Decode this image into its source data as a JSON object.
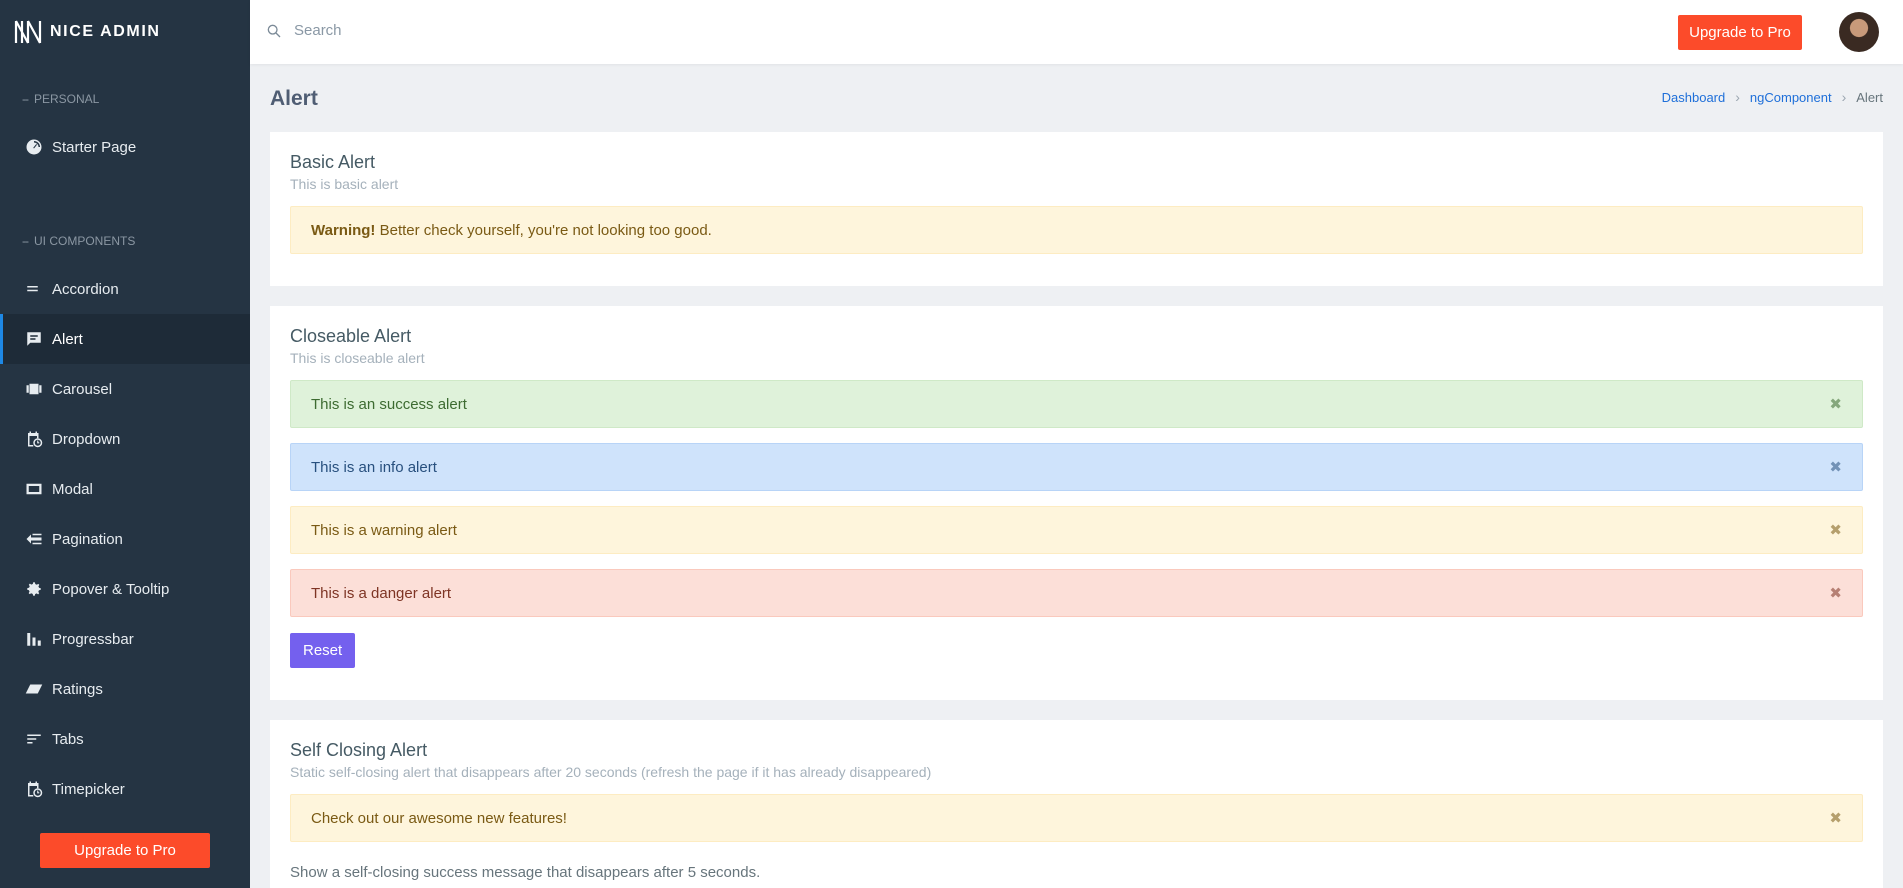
{
  "brand": {
    "name": "NICE ADMIN"
  },
  "sidebar": {
    "caption_personal": "PERSONAL",
    "caption_ui": "UI COMPONENTS",
    "starter": "Starter Page",
    "items": [
      {
        "label": "Accordion",
        "icon": "menu-icon"
      },
      {
        "label": "Alert",
        "icon": "comment-alert-icon"
      },
      {
        "label": "Carousel",
        "icon": "carousel-icon"
      },
      {
        "label": "Dropdown",
        "icon": "calendar-clock-icon"
      },
      {
        "label": "Modal",
        "icon": "window-icon"
      },
      {
        "label": "Pagination",
        "icon": "arrow-left-list-icon"
      },
      {
        "label": "Popover & Tooltip",
        "icon": "gear-icon"
      },
      {
        "label": "Progressbar",
        "icon": "bar-chart-icon"
      },
      {
        "label": "Ratings",
        "icon": "parallelogram-icon"
      },
      {
        "label": "Tabs",
        "icon": "sort-lines-icon"
      },
      {
        "label": "Timepicker",
        "icon": "calendar-clock-icon"
      }
    ],
    "active": "Alert",
    "upgrade": "Upgrade to Pro"
  },
  "topbar": {
    "search_placeholder": "Search",
    "upgrade": "Upgrade to Pro"
  },
  "page": {
    "title": "Alert",
    "breadcrumb": [
      "Dashboard",
      "ngComponent",
      "Alert"
    ]
  },
  "basic": {
    "title": "Basic Alert",
    "subtitle": "This is basic alert",
    "alert_strong": "Warning!",
    "alert_text": " Better check yourself, you're not looking too good."
  },
  "closeable": {
    "title": "Closeable Alert",
    "subtitle": "This is closeable alert",
    "alerts": [
      {
        "type": "success",
        "text": "This is an success alert"
      },
      {
        "type": "info",
        "text": "This is an info alert"
      },
      {
        "type": "warning",
        "text": "This is a warning alert"
      },
      {
        "type": "danger",
        "text": "This is a danger alert"
      }
    ],
    "close_glyph": "✖",
    "reset": "Reset"
  },
  "selfclosing": {
    "title": "Self Closing Alert",
    "subtitle": "Static self-closing alert that disappears after 20 seconds (refresh the page if it has already disappeared)",
    "alert_text": "Check out our awesome new features!",
    "note": "Show a self-closing success message that disappears after 5 seconds."
  },
  "colors": {
    "sidebar_bg": "#253443",
    "accent_orange": "#fc4b2a",
    "reset_purple": "#7460ee",
    "active_bar": "#1e88e5"
  }
}
